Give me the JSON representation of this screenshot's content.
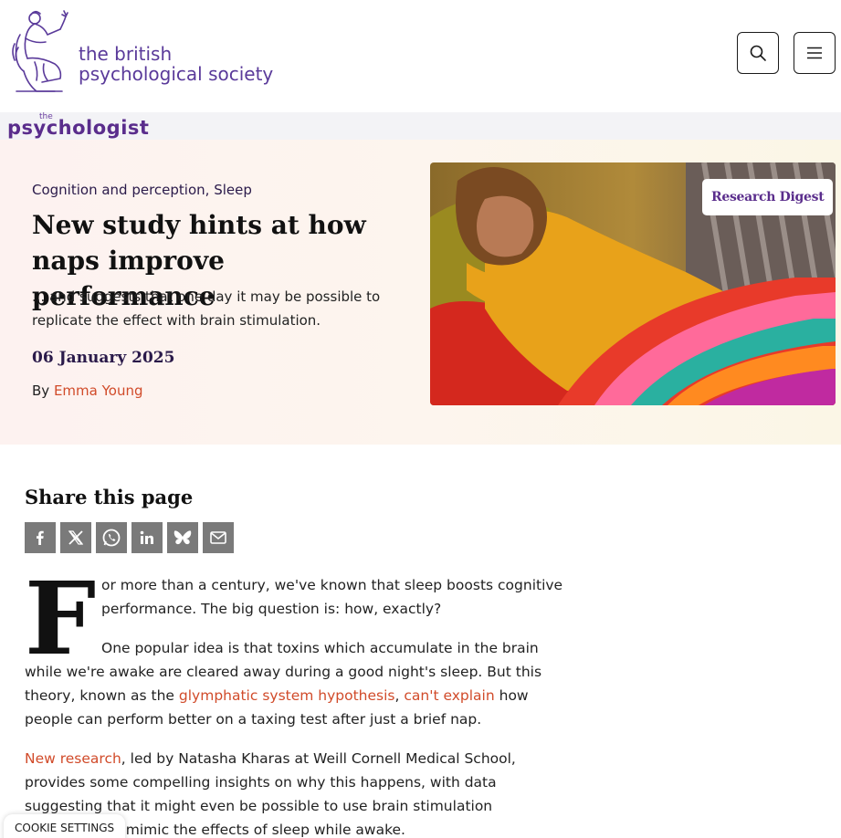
{
  "header": {
    "org_line1": "the british",
    "org_line2": "psychological society",
    "search_label": "Search",
    "menu_label": "Menu"
  },
  "subbrand": {
    "small": "the",
    "name": "psychologist"
  },
  "hero": {
    "category1": "Cognition and perception",
    "category_sep": ", ",
    "category2": "Sleep",
    "headline": "New study hints at how naps improve performance",
    "standfirst": "... and suggests that one day it may be possible to replicate the effect with brain stimulation.",
    "date": "06 January 2025",
    "by_prefix": "By ",
    "author": "Emma Young",
    "image_badge": "Research Digest"
  },
  "share": {
    "title": "Share this page",
    "buttons": [
      "facebook",
      "x",
      "whatsapp",
      "linkedin",
      "bluesky",
      "email"
    ]
  },
  "article": {
    "dropcap": "F",
    "p1": "or more than a century, we've known that sleep boosts cognitive performance. The big question is: how, exactly?",
    "p2_a": "One popular idea is that toxins which accumulate in the brain while we're awake are cleared away during a good night's sleep. But this theory, known as the ",
    "p2_link1": "glymphatic system hypothesis",
    "p2_b": ", ",
    "p2_link2": "can't explain",
    "p2_c": " how people can perform better on a taxing test after just a brief nap.",
    "p3_link": "New research",
    "p3_text": ", led by Natasha Kharas at Weill Cornell Medical School, provides some compelling insights on why this happens, with data suggesting that it might even be possible to use brain stimulation techniques to mimic the effects of sleep while awake."
  },
  "cookie": {
    "label": "COOKIE SETTINGS"
  },
  "colors": {
    "brand_purple": "#5a2d8c",
    "link_orange": "#d14b2a",
    "share_grey": "#7a7a7a"
  }
}
